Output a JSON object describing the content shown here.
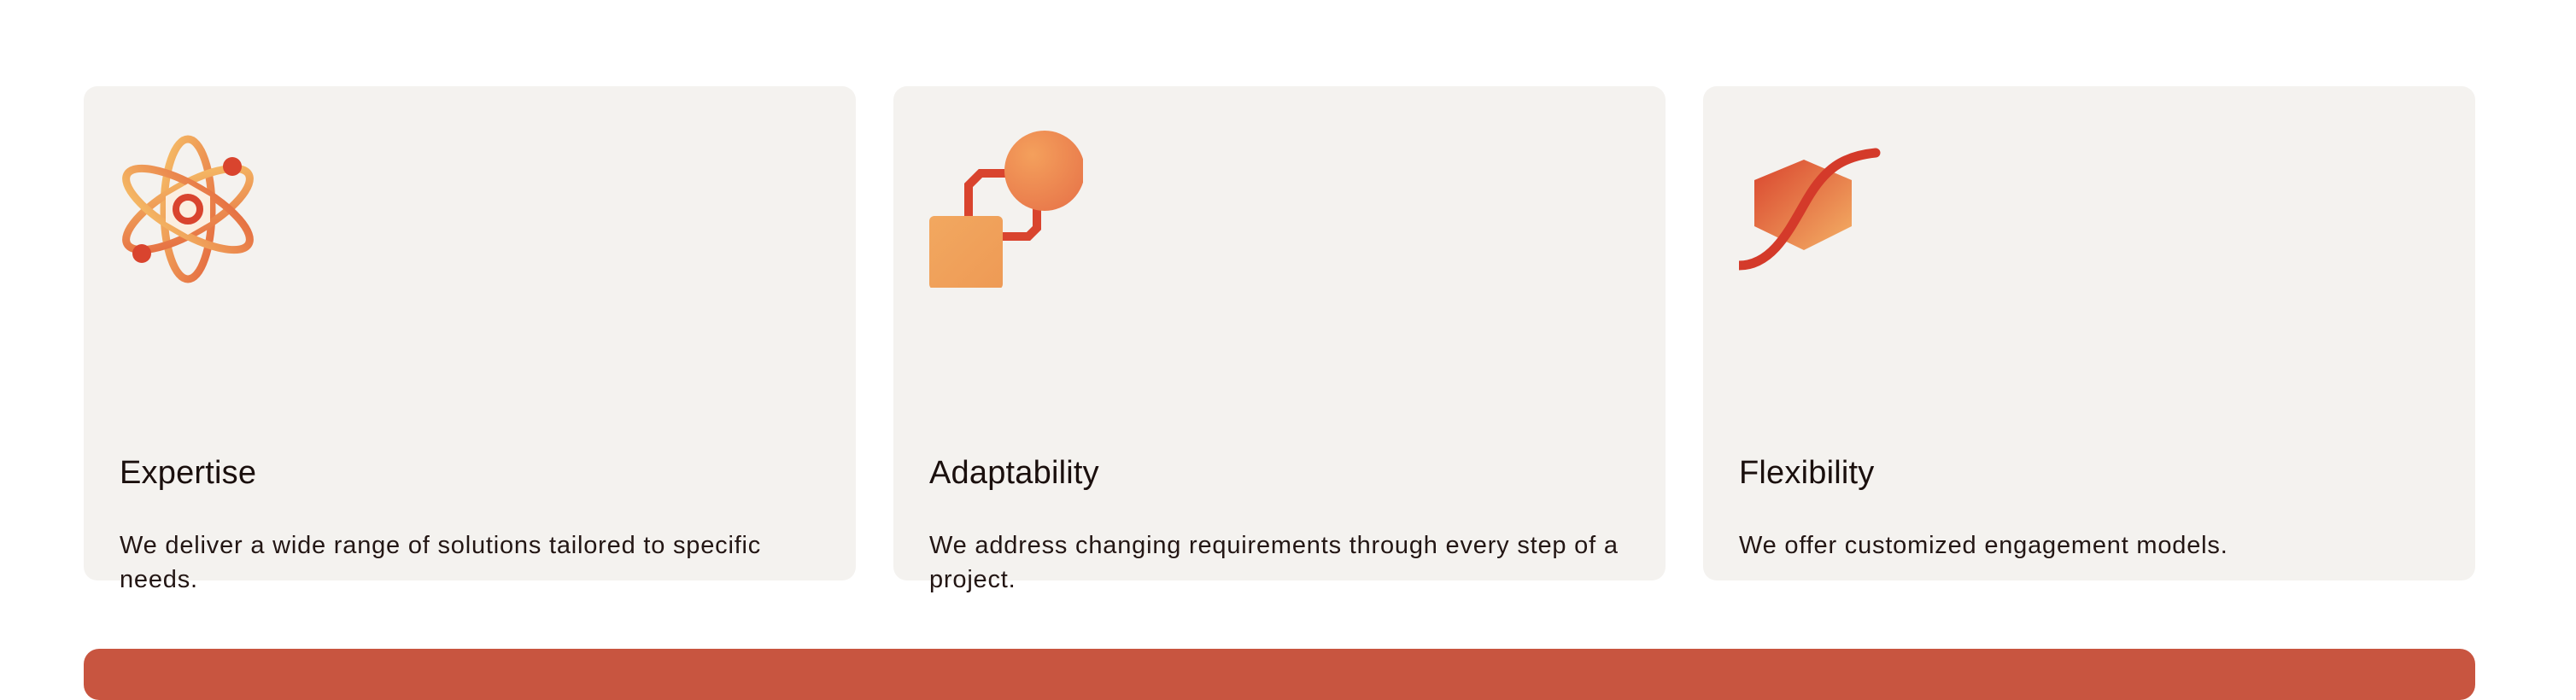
{
  "cards": [
    {
      "icon": "atom-icon",
      "title": "Expertise",
      "description": "We deliver a wide range of solutions tailored to specific needs."
    },
    {
      "icon": "linked-shapes-icon",
      "title": "Adaptability",
      "description": "We address changing requirements through every step of a project."
    },
    {
      "icon": "hexagon-wave-icon",
      "title": "Flexibility",
      "description": "We offer customized engagement models."
    }
  ],
  "colors": {
    "card_background": "#f4f2ef",
    "accent_orange": "#f0a65a",
    "accent_red": "#d9442e",
    "banner": "#c85540"
  }
}
